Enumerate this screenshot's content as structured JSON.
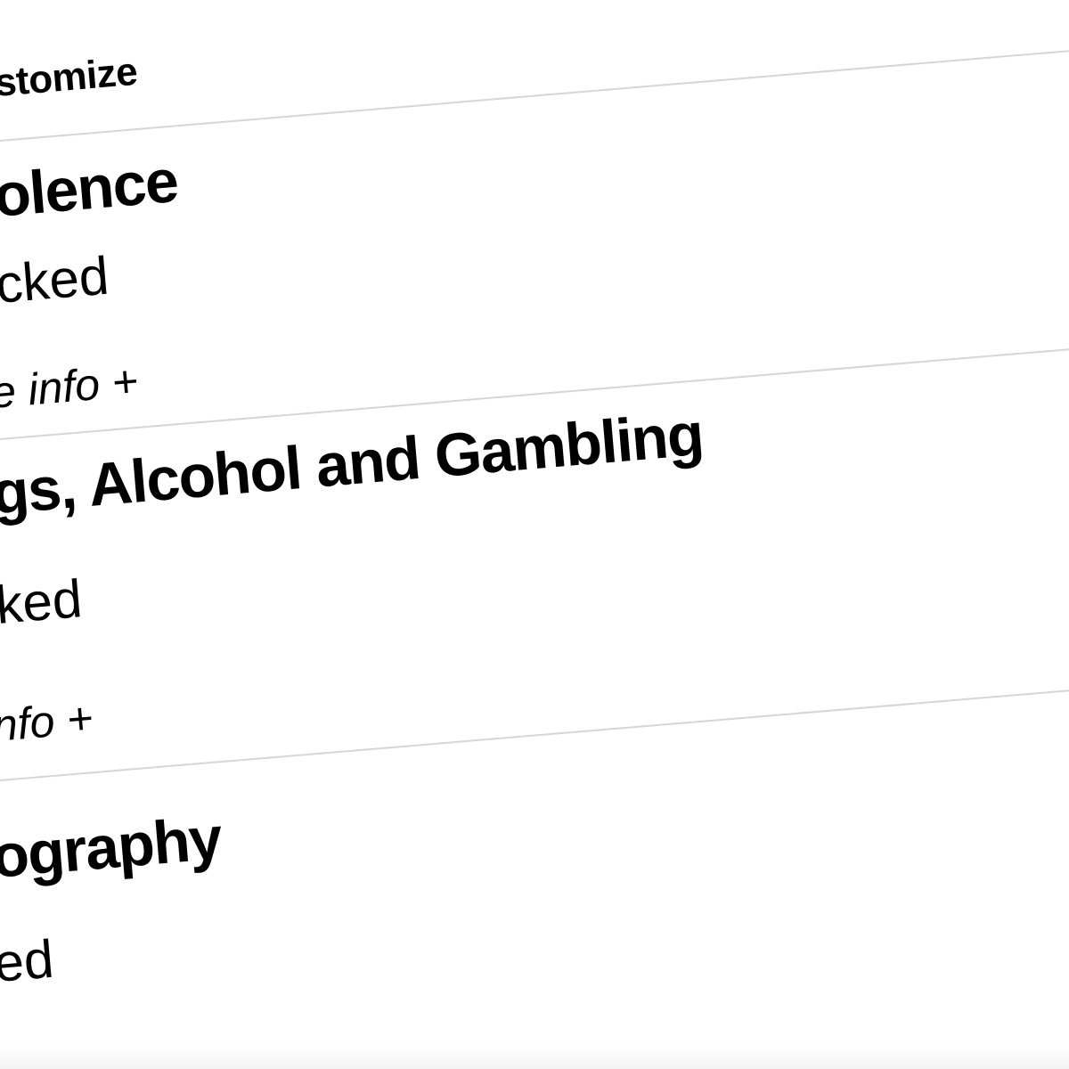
{
  "header": {
    "title": "stomize"
  },
  "categories": [
    {
      "name": "olence",
      "status": "cked",
      "info_label": "e info +"
    },
    {
      "name": "gs, Alcohol and Gambling",
      "status": "ked",
      "info_label": "nfo +"
    },
    {
      "name": "ography",
      "status": "ed"
    }
  ],
  "colors": {
    "text": "#000000",
    "divider": "#d6d6d6",
    "background": "#ffffff"
  }
}
